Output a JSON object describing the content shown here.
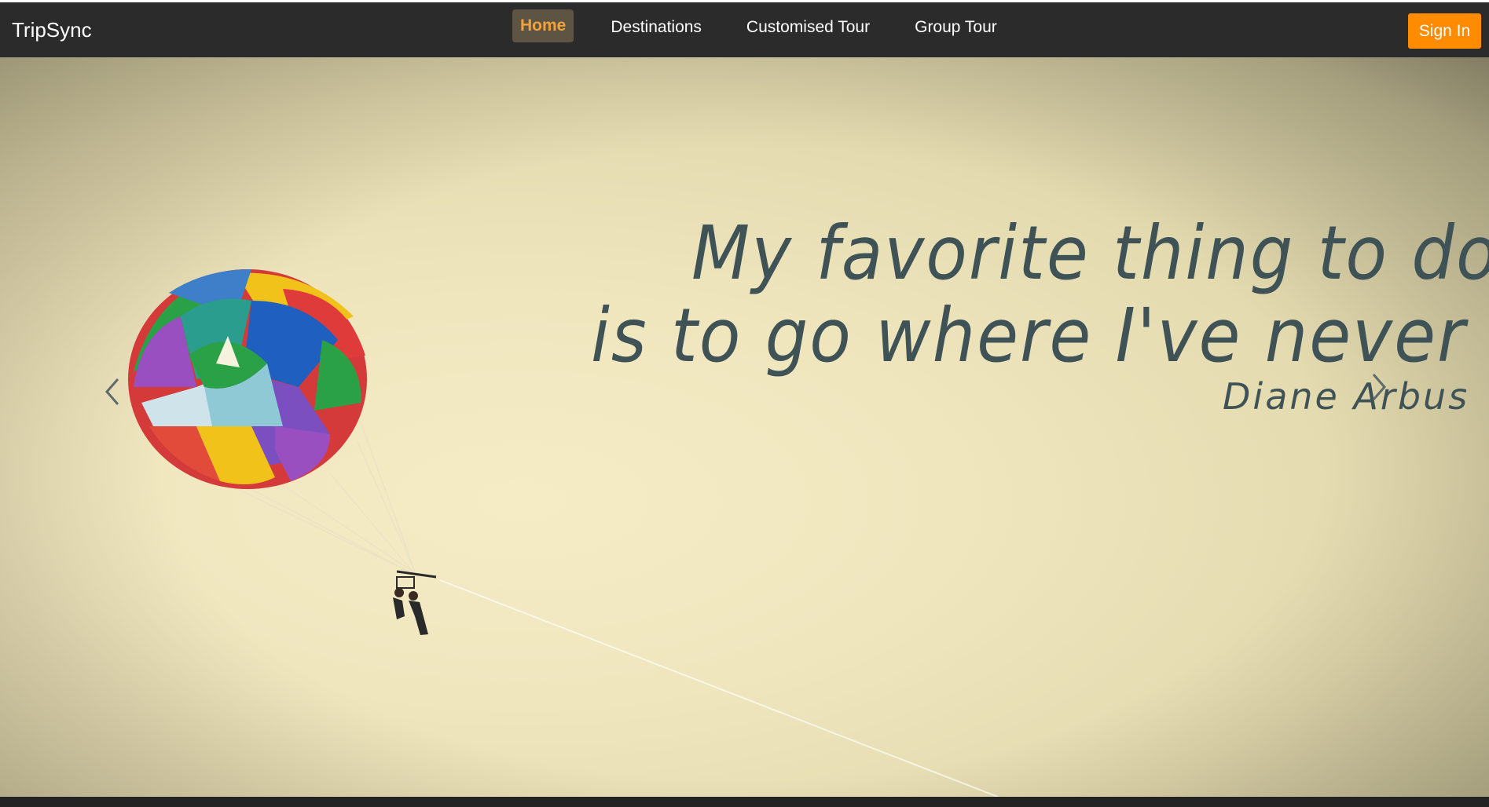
{
  "navbar": {
    "brand": "TripSync",
    "links": [
      {
        "label": "Home",
        "active": true
      },
      {
        "label": "Destinations",
        "active": false
      },
      {
        "label": "Customised Tour",
        "active": false
      },
      {
        "label": "Group Tour",
        "active": false
      }
    ],
    "signin_label": "Sign In"
  },
  "hero": {
    "quote_line1": "My favorite thing to do",
    "quote_line2": "is to go where I've never been.",
    "author": "Diane Arbus",
    "prev_icon": "chevron-left-icon",
    "next_icon": "chevron-right-icon"
  },
  "colors": {
    "navbar_bg": "#2b2b2b",
    "active_text": "#f2a23a",
    "active_bg": "#5e5444",
    "signin_bg": "#ff8c00",
    "quote_text": "#3f5357",
    "sky": "#efe5bd"
  }
}
